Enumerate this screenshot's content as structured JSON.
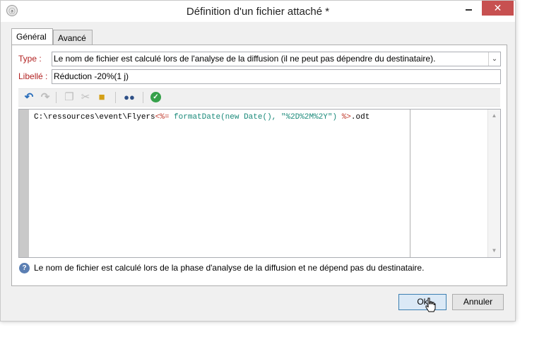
{
  "window": {
    "title": "Définition d'un fichier attaché *",
    "app_icon": "app-icon",
    "controls": {
      "minimize": "minimize-icon",
      "maximize": "maximize-icon",
      "close": "close-icon",
      "close_glyph": "✕"
    }
  },
  "tabs": [
    {
      "label": "Général",
      "active": true
    },
    {
      "label": "Avancé",
      "active": false
    }
  ],
  "form": {
    "type_label": "Type",
    "type_value": "Le nom de fichier est calculé lors de l'analyse de la diffusion (il ne peut pas dépendre du destinataire).",
    "libelle_label": "Libellé",
    "libelle_value": "Réduction -20%(1 j)"
  },
  "toolbar": {
    "icons": [
      "undo-icon",
      "redo-icon",
      "copy-icon",
      "cut-icon",
      "paste-icon",
      "find-icon",
      "validate-icon"
    ]
  },
  "editor": {
    "code_prefix": "C:\\ressources\\event\\Flyers",
    "code_tag_open": "<%=",
    "code_expr": " formatDate(new Date(), \"%2D%2M%2Y\") ",
    "code_tag_close": "%>",
    "code_suffix": ".odt"
  },
  "help": {
    "text": "Le nom de fichier est calculé lors de la phase d'analyse de la diffusion et ne dépend pas du destinataire."
  },
  "buttons": {
    "ok_label": "Ok",
    "cancel_label": "Annuler"
  },
  "colors": {
    "label_red": "#b22222",
    "close_button": "#c75050",
    "code_tag": "#c0392b",
    "code_expr": "#1a8a7a"
  }
}
